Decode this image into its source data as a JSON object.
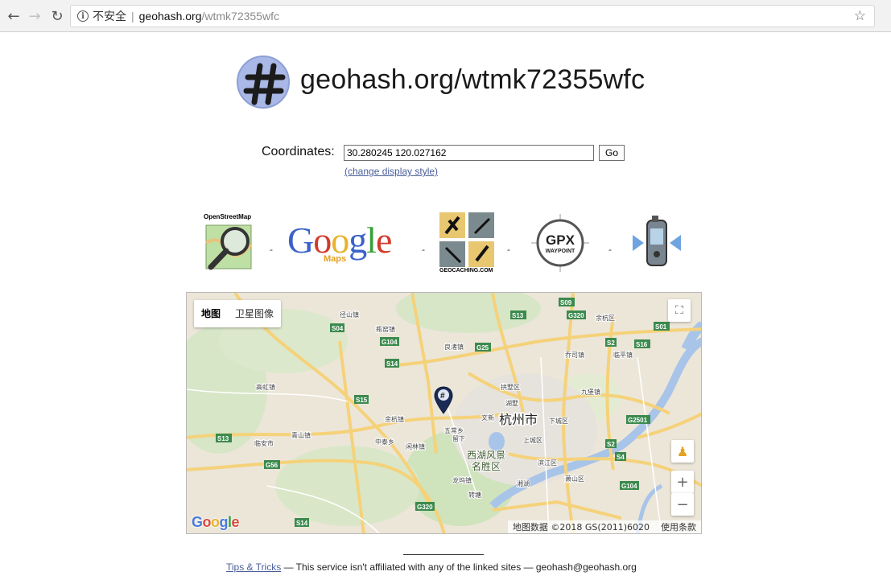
{
  "browser": {
    "insecure_label": "不安全",
    "url_host": "geohash.org",
    "url_path": "/wtmk72355wfc"
  },
  "header": {
    "title": "geohash.org/wtmk72355wfc"
  },
  "form": {
    "coordinates_label": "Coordinates:",
    "coordinates_value": "30.280245 120.027162",
    "go_label": "Go",
    "change_style_label": "(change display style)"
  },
  "services": {
    "separator": "-",
    "osm_caption": "OpenStreetMap",
    "google_sub": "Maps",
    "geocaching_caption": "GEOCACHING.COM",
    "gpx_line1": "GPX",
    "gpx_line2": "WAYPOINT"
  },
  "map": {
    "type_map": "地图",
    "type_satellite": "卫星图像",
    "attribution": "地图数据 ©2018 GS(2011)6020",
    "terms": "使用条款",
    "labels": {
      "hangzhou": "杭州市",
      "westlake1": "西湖风景",
      "westlake2": "名胜区",
      "yuhang": "余杭镇",
      "xianlin": "闲林镇",
      "wuchang": "五常乡",
      "liuxia": "留下",
      "wenxin": "文新",
      "gongshu": "拱墅区",
      "xiacheng": "下城区",
      "shangcheng": "上城区",
      "binjiang": "滨江区",
      "xiaoshan": "萧山区",
      "gaohong": "高虹镇",
      "jingshan": "径山镇",
      "pingyao": "瓶窑镇",
      "liangzhu": "良渚镇",
      "yuhangqu": "余杭区",
      "linping": "临平镇",
      "lin_an": "临安市",
      "zhongtai": "中泰乡",
      "qingshan": "青山镇",
      "longwu": "龙坞镇",
      "zhuantang": "转塘",
      "hushu": "湖墅",
      "qiaosi": "乔司镇",
      "xianghu": "湘湖",
      "jiuqiao": "九堡镇"
    },
    "roads": [
      "S04",
      "G104",
      "S14",
      "G25",
      "S13",
      "S09",
      "G320",
      "S2",
      "S16",
      "S01",
      "S15",
      "S13",
      "G56",
      "G320",
      "S14",
      "G2501",
      "S2",
      "S4",
      "G104"
    ]
  },
  "footer": {
    "tips_label": "Tips & Tricks",
    "text": " — This service isn't affiliated with any of the linked sites — geohash@geohash.org"
  }
}
